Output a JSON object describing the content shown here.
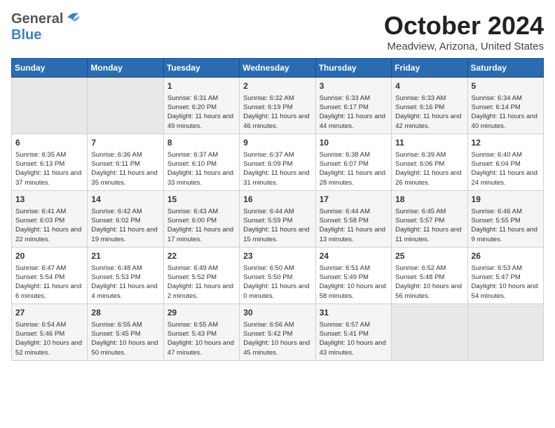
{
  "header": {
    "logo_general": "General",
    "logo_blue": "Blue",
    "month_title": "October 2024",
    "location": "Meadview, Arizona, United States"
  },
  "days_of_week": [
    "Sunday",
    "Monday",
    "Tuesday",
    "Wednesday",
    "Thursday",
    "Friday",
    "Saturday"
  ],
  "weeks": [
    [
      {
        "day": "",
        "sunrise": "",
        "sunset": "",
        "daylight": "",
        "empty": true
      },
      {
        "day": "",
        "sunrise": "",
        "sunset": "",
        "daylight": "",
        "empty": true
      },
      {
        "day": "1",
        "sunrise": "Sunrise: 6:31 AM",
        "sunset": "Sunset: 6:20 PM",
        "daylight": "Daylight: 11 hours and 49 minutes.",
        "empty": false
      },
      {
        "day": "2",
        "sunrise": "Sunrise: 6:32 AM",
        "sunset": "Sunset: 6:19 PM",
        "daylight": "Daylight: 11 hours and 46 minutes.",
        "empty": false
      },
      {
        "day": "3",
        "sunrise": "Sunrise: 6:33 AM",
        "sunset": "Sunset: 6:17 PM",
        "daylight": "Daylight: 11 hours and 44 minutes.",
        "empty": false
      },
      {
        "day": "4",
        "sunrise": "Sunrise: 6:33 AM",
        "sunset": "Sunset: 6:16 PM",
        "daylight": "Daylight: 11 hours and 42 minutes.",
        "empty": false
      },
      {
        "day": "5",
        "sunrise": "Sunrise: 6:34 AM",
        "sunset": "Sunset: 6:14 PM",
        "daylight": "Daylight: 11 hours and 40 minutes.",
        "empty": false
      }
    ],
    [
      {
        "day": "6",
        "sunrise": "Sunrise: 6:35 AM",
        "sunset": "Sunset: 6:13 PM",
        "daylight": "Daylight: 11 hours and 37 minutes.",
        "empty": false
      },
      {
        "day": "7",
        "sunrise": "Sunrise: 6:36 AM",
        "sunset": "Sunset: 6:11 PM",
        "daylight": "Daylight: 11 hours and 35 minutes.",
        "empty": false
      },
      {
        "day": "8",
        "sunrise": "Sunrise: 6:37 AM",
        "sunset": "Sunset: 6:10 PM",
        "daylight": "Daylight: 11 hours and 33 minutes.",
        "empty": false
      },
      {
        "day": "9",
        "sunrise": "Sunrise: 6:37 AM",
        "sunset": "Sunset: 6:09 PM",
        "daylight": "Daylight: 11 hours and 31 minutes.",
        "empty": false
      },
      {
        "day": "10",
        "sunrise": "Sunrise: 6:38 AM",
        "sunset": "Sunset: 6:07 PM",
        "daylight": "Daylight: 11 hours and 28 minutes.",
        "empty": false
      },
      {
        "day": "11",
        "sunrise": "Sunrise: 6:39 AM",
        "sunset": "Sunset: 6:06 PM",
        "daylight": "Daylight: 11 hours and 26 minutes.",
        "empty": false
      },
      {
        "day": "12",
        "sunrise": "Sunrise: 6:40 AM",
        "sunset": "Sunset: 6:04 PM",
        "daylight": "Daylight: 11 hours and 24 minutes.",
        "empty": false
      }
    ],
    [
      {
        "day": "13",
        "sunrise": "Sunrise: 6:41 AM",
        "sunset": "Sunset: 6:03 PM",
        "daylight": "Daylight: 11 hours and 22 minutes.",
        "empty": false
      },
      {
        "day": "14",
        "sunrise": "Sunrise: 6:42 AM",
        "sunset": "Sunset: 6:02 PM",
        "daylight": "Daylight: 11 hours and 19 minutes.",
        "empty": false
      },
      {
        "day": "15",
        "sunrise": "Sunrise: 6:43 AM",
        "sunset": "Sunset: 6:00 PM",
        "daylight": "Daylight: 11 hours and 17 minutes.",
        "empty": false
      },
      {
        "day": "16",
        "sunrise": "Sunrise: 6:44 AM",
        "sunset": "Sunset: 5:59 PM",
        "daylight": "Daylight: 11 hours and 15 minutes.",
        "empty": false
      },
      {
        "day": "17",
        "sunrise": "Sunrise: 6:44 AM",
        "sunset": "Sunset: 5:58 PM",
        "daylight": "Daylight: 11 hours and 13 minutes.",
        "empty": false
      },
      {
        "day": "18",
        "sunrise": "Sunrise: 6:45 AM",
        "sunset": "Sunset: 5:57 PM",
        "daylight": "Daylight: 11 hours and 11 minutes.",
        "empty": false
      },
      {
        "day": "19",
        "sunrise": "Sunrise: 6:46 AM",
        "sunset": "Sunset: 5:55 PM",
        "daylight": "Daylight: 11 hours and 9 minutes.",
        "empty": false
      }
    ],
    [
      {
        "day": "20",
        "sunrise": "Sunrise: 6:47 AM",
        "sunset": "Sunset: 5:54 PM",
        "daylight": "Daylight: 11 hours and 6 minutes.",
        "empty": false
      },
      {
        "day": "21",
        "sunrise": "Sunrise: 6:48 AM",
        "sunset": "Sunset: 5:53 PM",
        "daylight": "Daylight: 11 hours and 4 minutes.",
        "empty": false
      },
      {
        "day": "22",
        "sunrise": "Sunrise: 6:49 AM",
        "sunset": "Sunset: 5:52 PM",
        "daylight": "Daylight: 11 hours and 2 minutes.",
        "empty": false
      },
      {
        "day": "23",
        "sunrise": "Sunrise: 6:50 AM",
        "sunset": "Sunset: 5:50 PM",
        "daylight": "Daylight: 11 hours and 0 minutes.",
        "empty": false
      },
      {
        "day": "24",
        "sunrise": "Sunrise: 6:51 AM",
        "sunset": "Sunset: 5:49 PM",
        "daylight": "Daylight: 10 hours and 58 minutes.",
        "empty": false
      },
      {
        "day": "25",
        "sunrise": "Sunrise: 6:52 AM",
        "sunset": "Sunset: 5:48 PM",
        "daylight": "Daylight: 10 hours and 56 minutes.",
        "empty": false
      },
      {
        "day": "26",
        "sunrise": "Sunrise: 6:53 AM",
        "sunset": "Sunset: 5:47 PM",
        "daylight": "Daylight: 10 hours and 54 minutes.",
        "empty": false
      }
    ],
    [
      {
        "day": "27",
        "sunrise": "Sunrise: 6:54 AM",
        "sunset": "Sunset: 5:46 PM",
        "daylight": "Daylight: 10 hours and 52 minutes.",
        "empty": false
      },
      {
        "day": "28",
        "sunrise": "Sunrise: 6:55 AM",
        "sunset": "Sunset: 5:45 PM",
        "daylight": "Daylight: 10 hours and 50 minutes.",
        "empty": false
      },
      {
        "day": "29",
        "sunrise": "Sunrise: 6:55 AM",
        "sunset": "Sunset: 5:43 PM",
        "daylight": "Daylight: 10 hours and 47 minutes.",
        "empty": false
      },
      {
        "day": "30",
        "sunrise": "Sunrise: 6:56 AM",
        "sunset": "Sunset: 5:42 PM",
        "daylight": "Daylight: 10 hours and 45 minutes.",
        "empty": false
      },
      {
        "day": "31",
        "sunrise": "Sunrise: 6:57 AM",
        "sunset": "Sunset: 5:41 PM",
        "daylight": "Daylight: 10 hours and 43 minutes.",
        "empty": false
      },
      {
        "day": "",
        "sunrise": "",
        "sunset": "",
        "daylight": "",
        "empty": true
      },
      {
        "day": "",
        "sunrise": "",
        "sunset": "",
        "daylight": "",
        "empty": true
      }
    ]
  ]
}
